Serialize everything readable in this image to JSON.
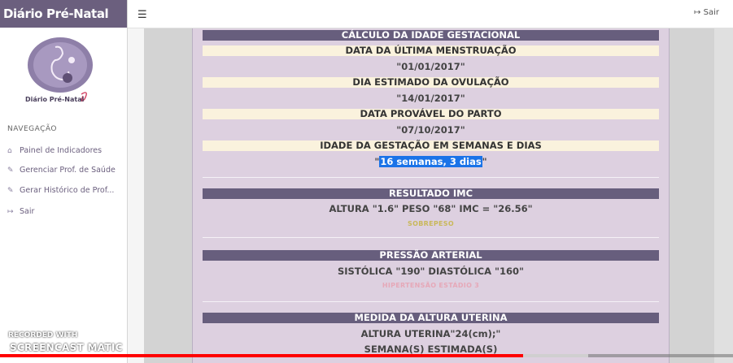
{
  "app": {
    "brand": "Diário Pré-Natal",
    "logo_text": "Diário Pré-Natal"
  },
  "sidebar": {
    "section_title": "NAVEGAÇÃO",
    "items": [
      {
        "label": "Painel de Indicadores",
        "icon": "home-icon"
      },
      {
        "label": "Gerenciar Prof. de Saúde",
        "icon": "edit-icon"
      },
      {
        "label": "Gerar Histórico de Prof...",
        "icon": "edit-icon"
      },
      {
        "label": "Sair",
        "icon": "sign-out-icon"
      }
    ]
  },
  "topbar": {
    "logout_label": "Sair"
  },
  "gestation": {
    "title": "CÁLCULO DA IDADE GESTACIONAL",
    "lmp_label": "DATA DA ÚLTIMA MENSTRUAÇÃO",
    "lmp_value": "\"01/01/2017\"",
    "ovulation_label": "DIA ESTIMADO DA OVULAÇÃO",
    "ovulation_value": "\"14/01/2017\"",
    "due_label": "DATA PROVÁVEL DO PARTO",
    "due_value": "\"07/10/2017\"",
    "age_label": "IDADE DA GESTAÇÃO EM SEMANAS E DIAS",
    "age_value": "16 semanas, 3 dias"
  },
  "imc": {
    "title": "RESULTADO IMC",
    "values": "ALTURA \"1.6\" PESO \"68\" IMC = \"26.56\"",
    "status": "SOBREPESO"
  },
  "pressure": {
    "title": "PRESSÃO ARTERIAL",
    "values": "SISTÓLICA \"190\" DIASTÓLICA \"160\"",
    "status": "HIPERTENSÃO ESTÁDIO 3"
  },
  "uterine": {
    "title": "MEDIDA DA ALTURA UTERINA",
    "values": "ALTURA UTERINA\"24(cm);\"",
    "weeks": "SEMANA(S) ESTIMADA(S)"
  },
  "overlay": {
    "rec_label": "RECORDED WITH",
    "brand": "SCREENCAST MATIC"
  },
  "video": {
    "progress": 0.714
  },
  "colors": {
    "accent": "#6b5f7e",
    "panel": "#ddd0e0",
    "highlight": "#1a73e8",
    "progress": "#ff0000"
  }
}
